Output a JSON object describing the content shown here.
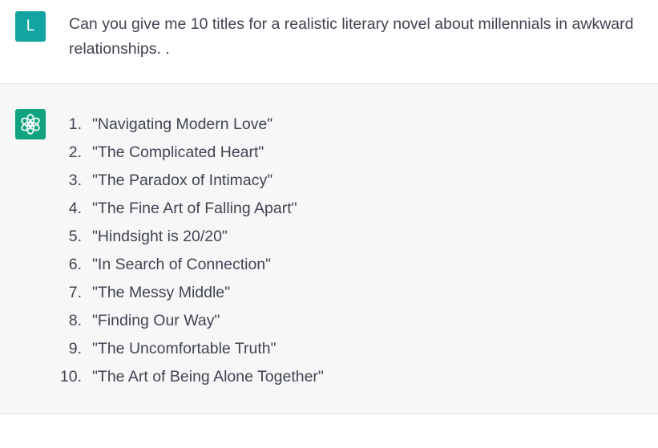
{
  "colors": {
    "user_avatar": "#13a3a0",
    "bot_avatar": "#10a37f",
    "assistant_background": "#f7f7f8"
  },
  "user_message": {
    "avatar_letter": "L",
    "text": "Can you give me 10 titles for a realistic literary novel about millennials in awkward relationships. ."
  },
  "assistant_message": {
    "avatar_icon": "openai-logo-icon",
    "items": [
      {
        "number": "1.",
        "text": "\"Navigating Modern Love\""
      },
      {
        "number": "2.",
        "text": "\"The Complicated Heart\""
      },
      {
        "number": "3.",
        "text": "\"The Paradox of Intimacy\""
      },
      {
        "number": "4.",
        "text": "\"The Fine Art of Falling Apart\""
      },
      {
        "number": "5.",
        "text": "\"Hindsight is 20/20\""
      },
      {
        "number": "6.",
        "text": "\"In Search of Connection\""
      },
      {
        "number": "7.",
        "text": "\"The Messy Middle\""
      },
      {
        "number": "8.",
        "text": "\"Finding Our Way\""
      },
      {
        "number": "9.",
        "text": "\"The Uncomfortable Truth\""
      },
      {
        "number": "10.",
        "text": "\"The Art of Being Alone Together\""
      }
    ]
  }
}
